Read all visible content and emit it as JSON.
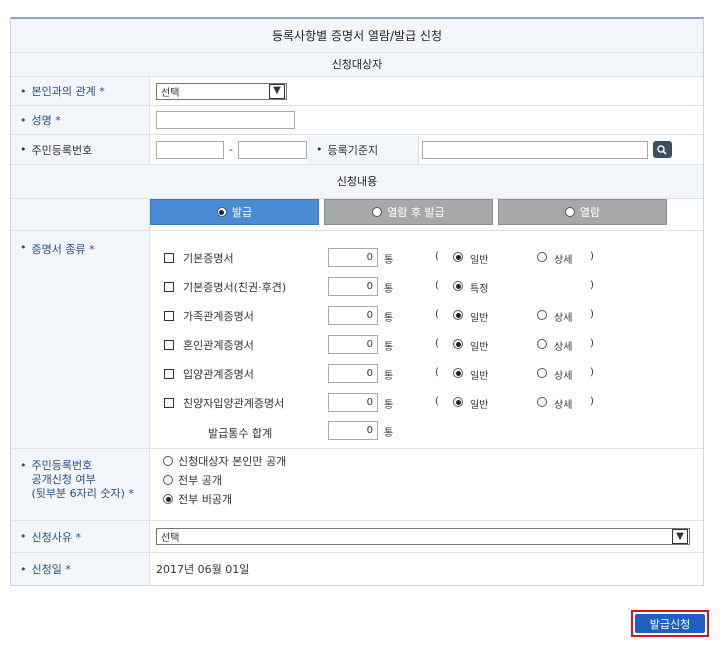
{
  "title": "등록사항별 증명서 열람/발급 신청",
  "section_target": "신청대상자",
  "section_content": "신청내용",
  "relation": {
    "label": "본인과의 관계 *",
    "value": "선택"
  },
  "name": {
    "label": "성명 *",
    "value": ""
  },
  "rrn": {
    "label": "주민등록번호",
    "dash": "-",
    "first": "",
    "second": ""
  },
  "domicile": {
    "label": "등록기준지",
    "value": ""
  },
  "tabs": [
    "발급",
    "열람 후 발급",
    "열람"
  ],
  "cert_type_label": "증명서 종류 *",
  "cert_unit": "통",
  "open_paren": "(",
  "close_paren": ")",
  "certs": [
    {
      "name": "기본증명서",
      "count": "0",
      "opt1": "일반",
      "opt2": "상세"
    },
    {
      "name": "기본증명서(친권·후견)",
      "count": "0",
      "opt1": "특정",
      "opt2": ""
    },
    {
      "name": "가족관계증명서",
      "count": "0",
      "opt1": "일반",
      "opt2": "상세"
    },
    {
      "name": "혼인관계증명서",
      "count": "0",
      "opt1": "일반",
      "opt2": "상세"
    },
    {
      "name": "입양관계증명서",
      "count": "0",
      "opt1": "일반",
      "opt2": "상세"
    },
    {
      "name": "친양자입양관계증명서",
      "count": "0",
      "opt1": "일반",
      "opt2": "상세"
    }
  ],
  "total": {
    "label": "발급통수 합계",
    "value": "0"
  },
  "disclosure": {
    "label_lines": [
      "주민등록번호",
      "공개신청 여부",
      "(뒷부분 6자리 숫자) *"
    ],
    "options": [
      "신청대상자 본인만 공개",
      "전부 공개",
      "전부 비공개"
    ]
  },
  "reason": {
    "label": "신청사유 *",
    "value": "선택"
  },
  "date": {
    "label": "신청일 *",
    "value": "2017년 06월 01일"
  },
  "submit_label": "발급신청"
}
